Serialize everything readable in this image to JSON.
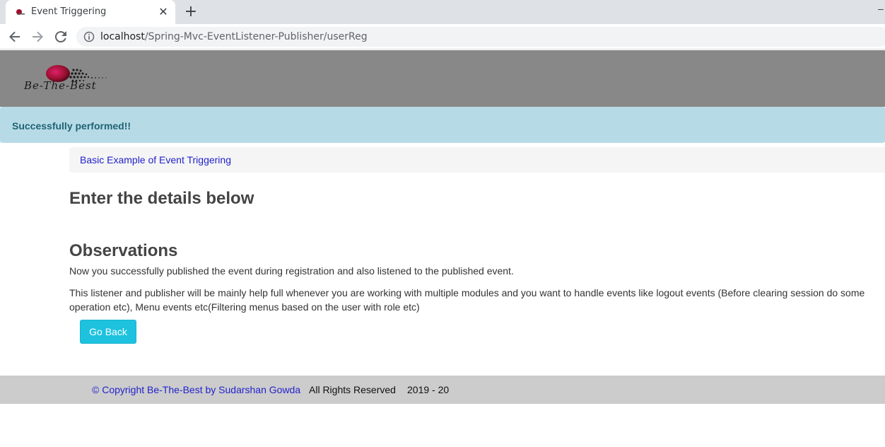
{
  "browser": {
    "tab_title": "Event Triggering",
    "tab_close": "✕",
    "new_tab": "+",
    "window_minimize": "–",
    "url_host": "localhost",
    "url_path": "/Spring-Mvc-EventListener-Publisher/userReg"
  },
  "header": {
    "logo_text": "Be-The-Best"
  },
  "alert": {
    "message": "Successfully performed!!"
  },
  "breadcrumb": {
    "link": "Basic Example of Event Triggering"
  },
  "main": {
    "heading": "Enter the details below",
    "observations_heading": "Observations",
    "paragraph1": "Now you successfully published the event during registration and also listened to the published event.",
    "paragraph2": "This listener and publisher will be mainly help full whenever you are working with multiple modules and you want to handle events like logout events (Before clearing session do some operation etc), Menu events etc(Filtering menus based on the user with role etc)",
    "go_back_label": "Go Back"
  },
  "footer": {
    "copyright": "© Copyright Be-The-Best by Sudarshan Gowda",
    "rights": "All Rights Reserved",
    "years": "2019 - 20"
  },
  "colors": {
    "header_bg": "#888888",
    "alert_bg": "#b7dbe6",
    "alert_text": "#1f6374",
    "button_bg": "#1ec2df",
    "footer_bg": "#cccccc",
    "link": "#2222cc"
  }
}
